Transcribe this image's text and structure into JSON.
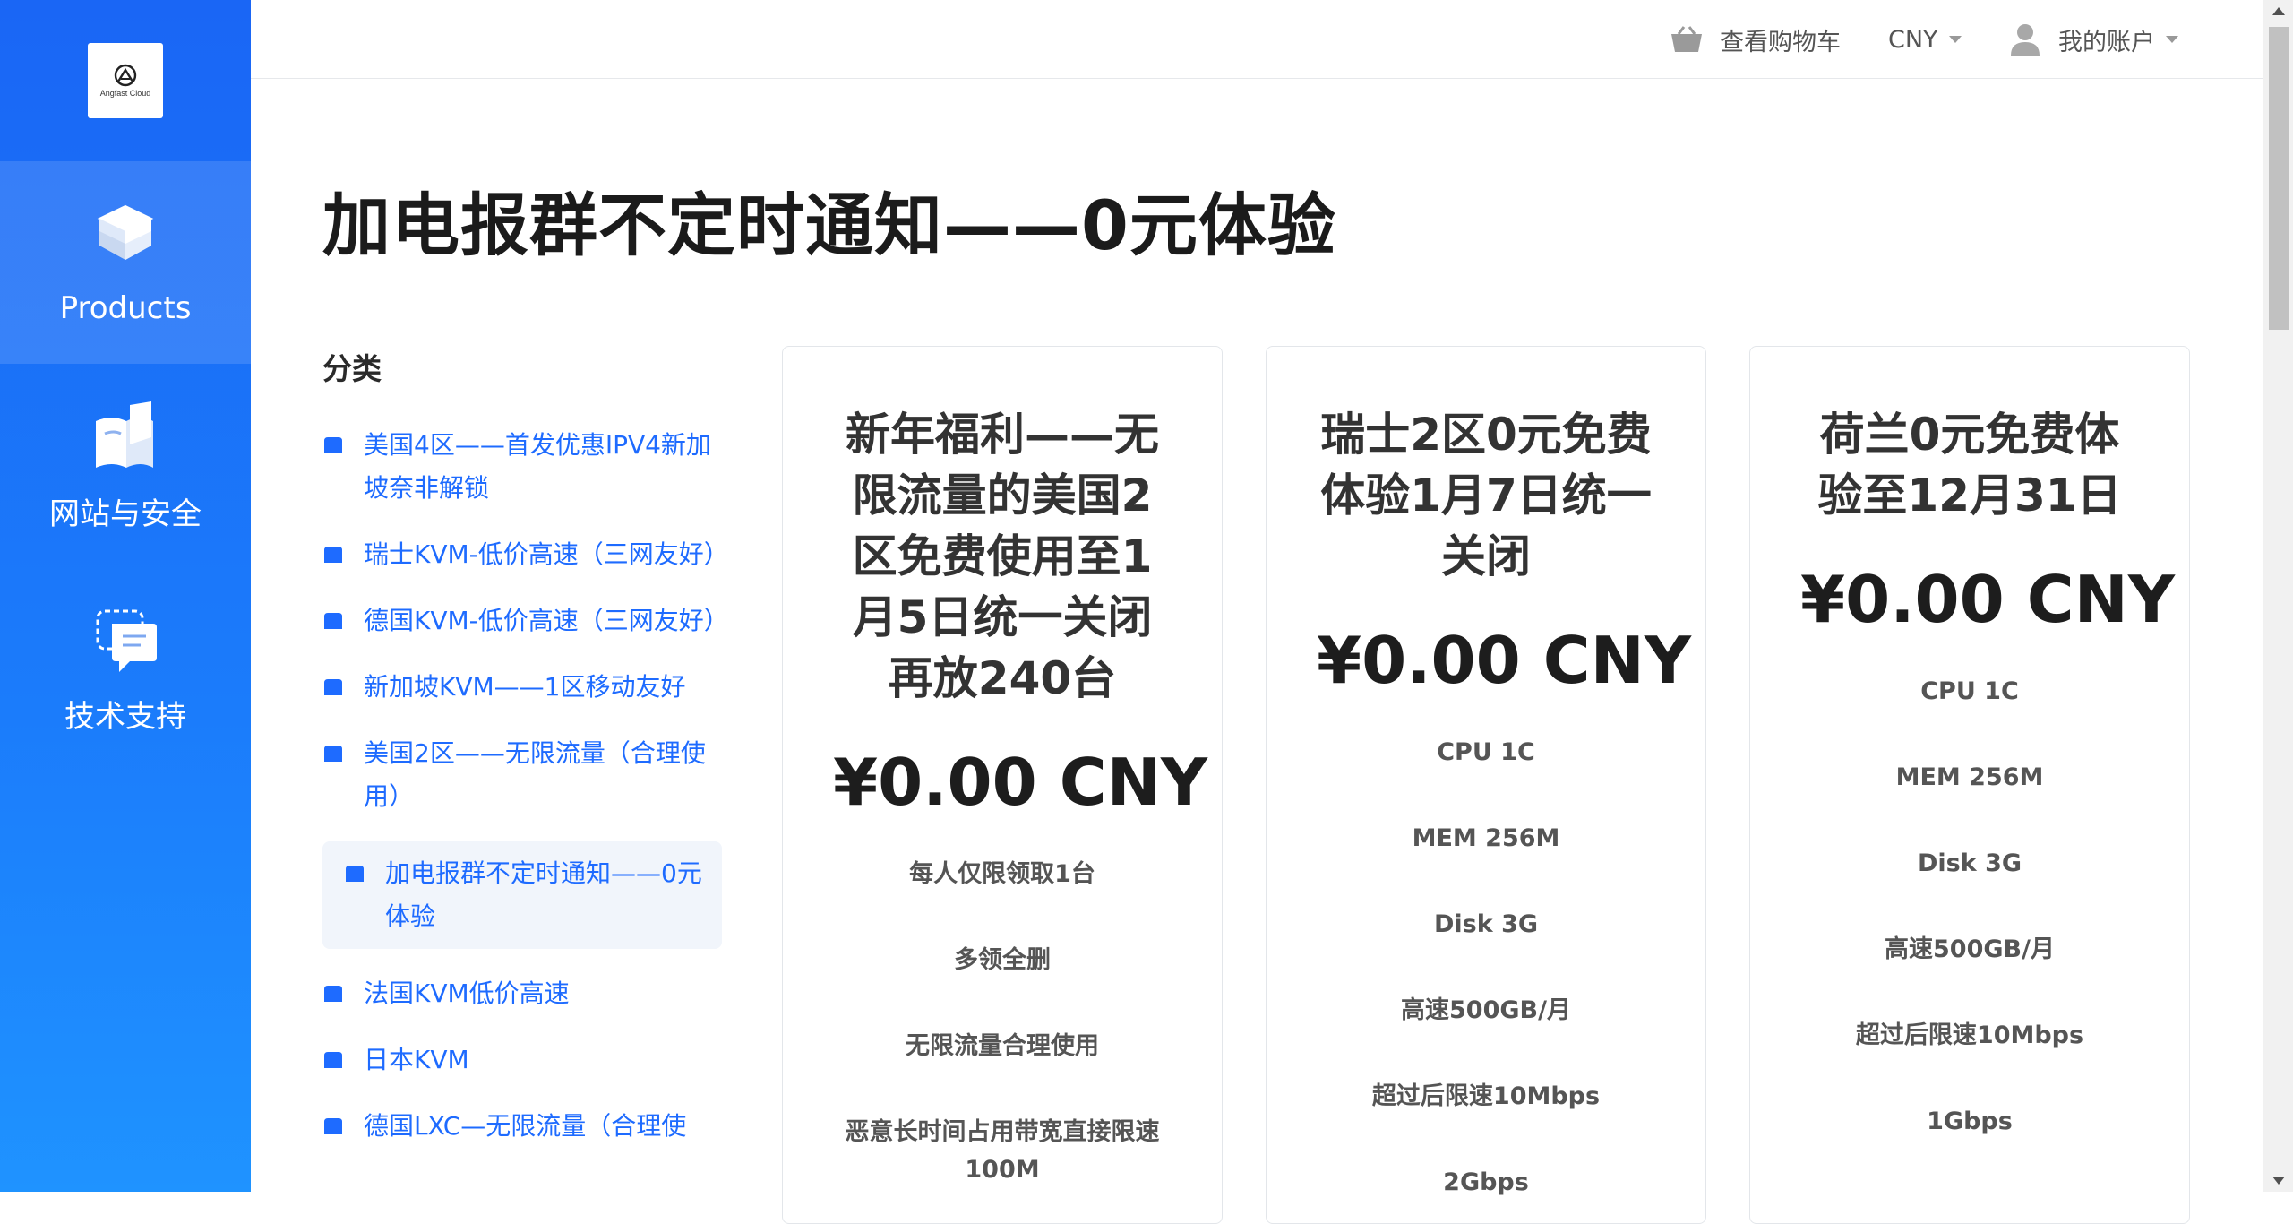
{
  "logo": {
    "brand": "Angfast Cloud"
  },
  "sidebar": {
    "items": [
      {
        "label": "Products"
      },
      {
        "label": "网站与安全"
      },
      {
        "label": "技术支持"
      }
    ]
  },
  "header": {
    "cart_label": "查看购物车",
    "currency": "CNY",
    "account_label": "我的账户"
  },
  "page": {
    "title": "加电报群不定时通知——0元体验"
  },
  "categories": {
    "heading": "分类",
    "items": [
      {
        "label": "美国4区——首发优惠IPV4新加坡奈非解锁"
      },
      {
        "label": "瑞士KVM-低价高速（三网友好）"
      },
      {
        "label": "德国KVM-低价高速（三网友好）"
      },
      {
        "label": "新加坡KVM——1区移动友好"
      },
      {
        "label": "美国2区——无限流量（合理使用）"
      },
      {
        "label": "加电报群不定时通知——0元体验"
      },
      {
        "label": "法国KVM低价高速"
      },
      {
        "label": "日本KVM"
      },
      {
        "label": "德国LXC—无限流量（合理使"
      }
    ]
  },
  "products": [
    {
      "title": "新年福利——无限流量的美国2区免费使用至1月5日统一关闭再放240台",
      "price": "¥0.00 CNY",
      "features": [
        "每人仅限领取1台",
        "多领全删",
        "无限流量合理使用",
        "恶意长时间占用带宽直接限速100M"
      ]
    },
    {
      "title": "瑞士2区0元免费体验1月7日统一关闭",
      "price": "¥0.00 CNY",
      "features": [
        "CPU 1C",
        "MEM 256M",
        "Disk 3G",
        "高速500GB/月",
        "超过后限速10Mbps",
        "2Gbps"
      ]
    },
    {
      "title": "荷兰0元免费体验至12月31日",
      "price": "¥0.00 CNY",
      "features": [
        "CPU 1C",
        "MEM 256M",
        "Disk 3G",
        "高速500GB/月",
        "超过后限速10Mbps",
        "1Gbps"
      ]
    }
  ],
  "colors": {
    "sidebar_top": "#1a66f5",
    "sidebar_bottom": "#1f93ff",
    "link_blue": "#1e6bff",
    "active_bg": "#f1f5fb"
  },
  "icons": {
    "logo": "angfast-logo",
    "products": "stacked-boxes-icon",
    "security": "shield-book-icon",
    "support": "chat-bubble-icon",
    "cart": "basket-icon",
    "account": "user-icon",
    "category": "box-icon"
  }
}
